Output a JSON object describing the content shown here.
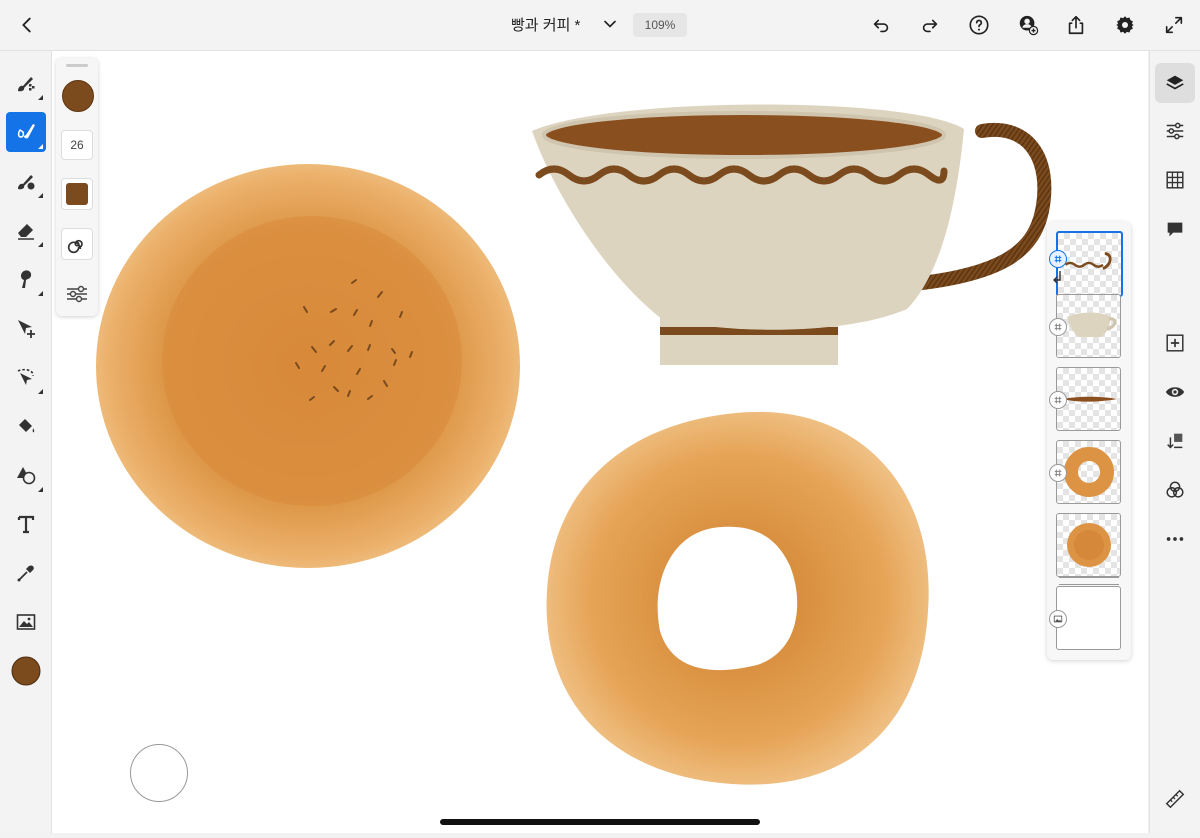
{
  "document": {
    "title": "빵과 커피 *",
    "zoom": "109%"
  },
  "props": {
    "brush_size": "26",
    "brush_color": "#7b4a1d"
  },
  "left_tools": [
    "pixel-brush",
    "live-brush",
    "mixer-brush",
    "eraser",
    "smudge",
    "transform",
    "selection",
    "fill",
    "shapes",
    "type",
    "eyedropper",
    "image",
    "color"
  ],
  "right_tools": [
    "layers",
    "layer-properties",
    "grid",
    "comments",
    "add-layer",
    "visibility",
    "merge",
    "blend",
    "more",
    "ruler"
  ],
  "layers": [
    {
      "name": "saucer",
      "selected": true
    },
    {
      "name": "cup"
    },
    {
      "name": "stick"
    },
    {
      "name": "donut"
    },
    {
      "name": "bun"
    },
    {
      "name": "background"
    }
  ],
  "colors": {
    "accent": "#1473e6",
    "brown": "#7b4a1d",
    "pastry": "#e3a55a",
    "cup": "#ddd4c0"
  }
}
